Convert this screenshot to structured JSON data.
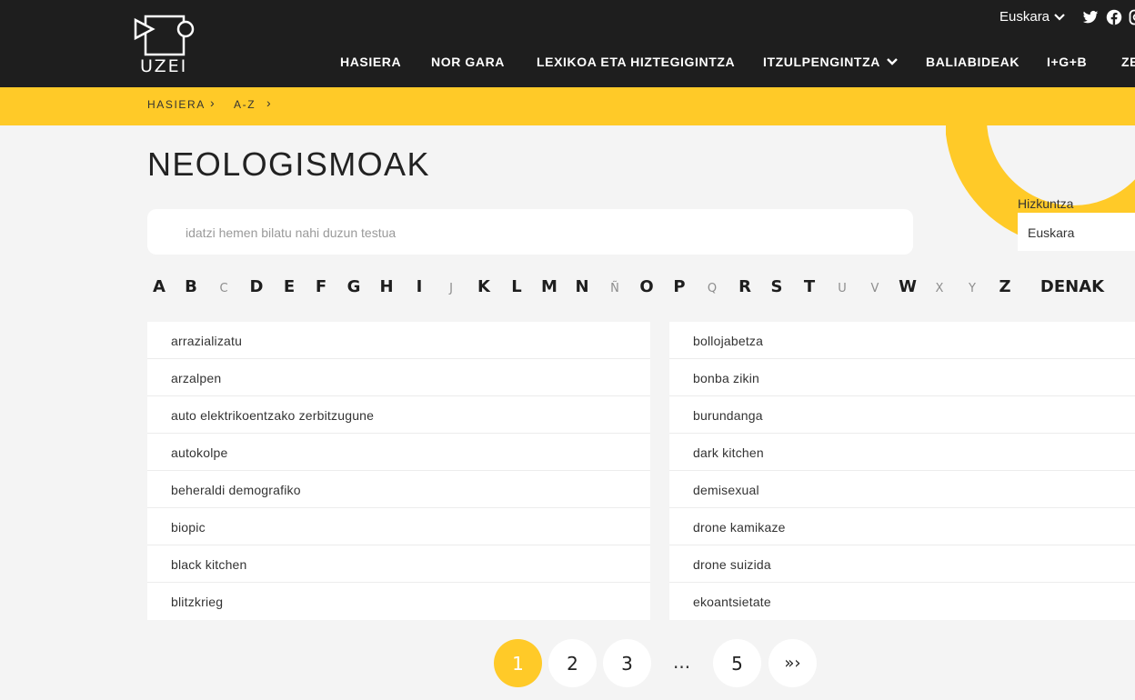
{
  "header": {
    "logo_text": "UZEI",
    "language": "Euskara",
    "social": [
      "twitter-icon",
      "facebook-icon",
      "instagram-icon"
    ],
    "nav": [
      {
        "label": "HASIERA"
      },
      {
        "label": "NOR GARA"
      },
      {
        "label": "LEXIKOA ETA HIZTEGIGINTZA"
      },
      {
        "label": "ITZULPENGINTZA",
        "has_dropdown": true
      },
      {
        "label": "BALIABIDEAK"
      },
      {
        "label": "I+G+B"
      },
      {
        "label": "ZE"
      }
    ]
  },
  "breadcrumb": [
    "HASIERA",
    "A-Z"
  ],
  "page": {
    "title": "NEOLOGISMOAK"
  },
  "search": {
    "placeholder": "idatzi hemen bilatu nahi duzun testua",
    "value": ""
  },
  "language_filter": {
    "label": "Hizkuntza",
    "selected": "Euskara"
  },
  "alphabet": [
    {
      "letter": "A",
      "enabled": true
    },
    {
      "letter": "B",
      "enabled": true
    },
    {
      "letter": "C",
      "enabled": false
    },
    {
      "letter": "D",
      "enabled": true
    },
    {
      "letter": "E",
      "enabled": true
    },
    {
      "letter": "F",
      "enabled": true
    },
    {
      "letter": "G",
      "enabled": true
    },
    {
      "letter": "H",
      "enabled": true
    },
    {
      "letter": "I",
      "enabled": true
    },
    {
      "letter": "J",
      "enabled": false
    },
    {
      "letter": "K",
      "enabled": true
    },
    {
      "letter": "L",
      "enabled": true
    },
    {
      "letter": "M",
      "enabled": true
    },
    {
      "letter": "N",
      "enabled": true
    },
    {
      "letter": "Ñ",
      "enabled": false
    },
    {
      "letter": "O",
      "enabled": true
    },
    {
      "letter": "P",
      "enabled": true
    },
    {
      "letter": "Q",
      "enabled": false
    },
    {
      "letter": "R",
      "enabled": true
    },
    {
      "letter": "S",
      "enabled": true
    },
    {
      "letter": "T",
      "enabled": true
    },
    {
      "letter": "U",
      "enabled": false
    },
    {
      "letter": "V",
      "enabled": false
    },
    {
      "letter": "W",
      "enabled": true
    },
    {
      "letter": "X",
      "enabled": false
    },
    {
      "letter": "Y",
      "enabled": false
    },
    {
      "letter": "Z",
      "enabled": true
    },
    {
      "letter": "DENAK",
      "enabled": true
    }
  ],
  "terms_left": [
    "arrazializatu",
    "arzalpen",
    "auto elektrikoentzako zerbitzugune",
    "autokolpe",
    "beheraldi demografiko",
    "biopic",
    "black kitchen",
    "blitzkrieg"
  ],
  "terms_right": [
    "bollojabetza",
    "bonba zikin",
    "burundanga",
    "dark kitchen",
    "demisexual",
    "drone kamikaze",
    "drone suizida",
    "ekoantsietate"
  ],
  "pagination": {
    "pages": [
      "1",
      "2",
      "3",
      "5"
    ],
    "current": "1",
    "ellipsis": "...",
    "next_label": "»›"
  },
  "colors": {
    "accent": "#ffca28",
    "header_bg": "#1e1e1e",
    "page_bg": "#f4f4f4"
  }
}
